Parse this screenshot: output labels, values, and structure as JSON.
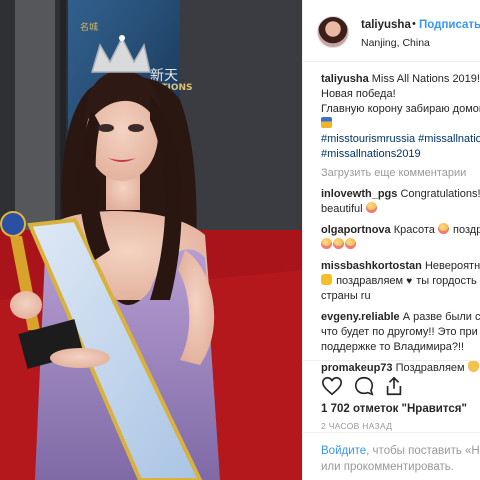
{
  "post": {
    "username": "taliyusha",
    "separator": "•",
    "follow_label": "Подписаться",
    "location": "Nanjing, China",
    "caption_username": "taliyusha",
    "caption_line1": "Miss All Nations 2019!",
    "caption_line2": "Новая победа!",
    "caption_line3": "Главную корону забираю домой",
    "hashtags_line1": "#misstourismrussia #missallnations",
    "hashtags_line2": "#missallnations2019",
    "load_more": "Загрузить еще комментарии"
  },
  "backdrop": {
    "banner_line1": "名城",
    "banner_line2": "ALL NATIONS",
    "banner_line3": "新天"
  },
  "comments": [
    {
      "user": "inlovewth_pgs",
      "text": "Congratulations! s",
      "text2": "beautiful"
    },
    {
      "user": "olgaportnova",
      "text": "Красота",
      "text_after": "поздр"
    },
    {
      "user": "missbashkortostan",
      "text": "Невероятная",
      "text2": "поздравляем",
      "text2b": "ты гордость",
      "text3": "страны ru"
    },
    {
      "user": "evgeny.reliable",
      "text": "А разве были со",
      "text2": "что будет по другому!! Это при",
      "text3": "поддержке то Владимира?!!"
    },
    {
      "user": "promakeup73",
      "text": "Поздравляем"
    }
  ],
  "actions": {
    "like_icon": "heart-icon",
    "comment_icon": "comment-icon",
    "share_icon": "share-icon",
    "likes": "1 702 отметок \"Нравится\"",
    "time_ago": "2 ЧАСОВ НАЗАД"
  },
  "login": {
    "link": "Войдите",
    "text": ", чтобы поставить «Нра",
    "text2": "или прокомментировать."
  },
  "colors": {
    "link_blue": "#3897f0",
    "hashtag": "#003569",
    "carpet": "#b5161b"
  }
}
